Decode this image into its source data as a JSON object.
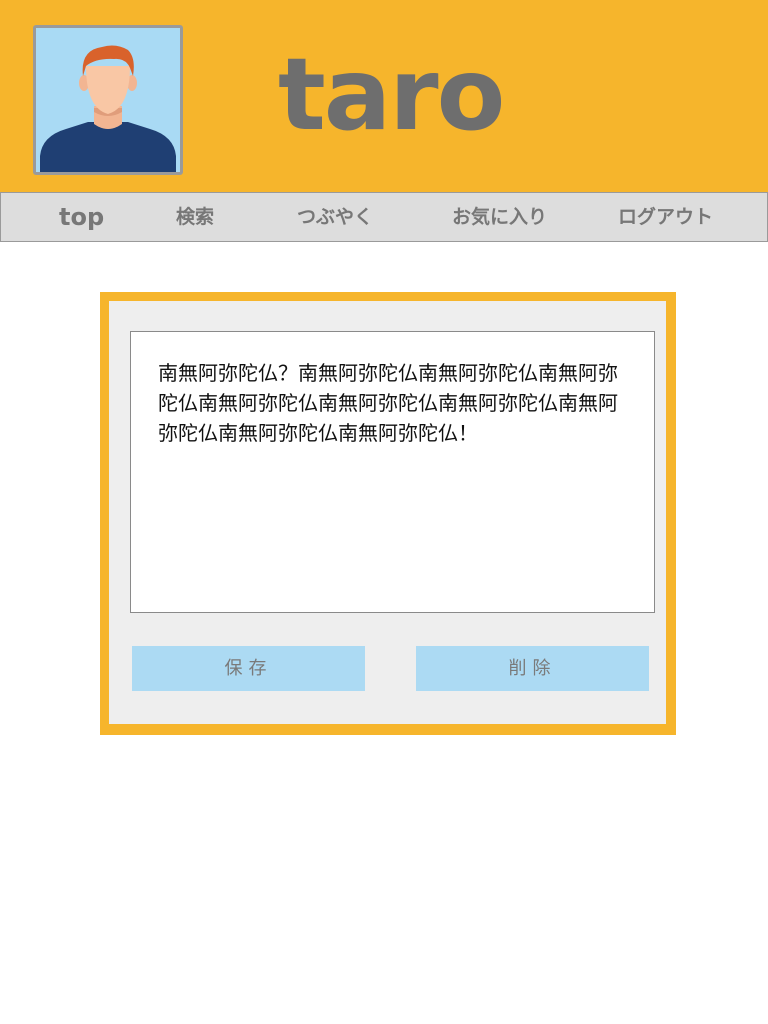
{
  "header": {
    "username": "taro",
    "avatar_icon": "user-avatar-icon",
    "background_color": "#F6B52C"
  },
  "nav": {
    "items": [
      {
        "label": "top"
      },
      {
        "label": "検索"
      },
      {
        "label": "つぶやく"
      },
      {
        "label": "お気に入り"
      },
      {
        "label": "ログアウト"
      }
    ]
  },
  "post": {
    "text": "南無阿弥陀仏？南無阿弥陀仏南無阿弥陀仏南無阿弥陀仏南無阿弥陀仏南無阿弥陀仏南無阿弥陀仏南無阿弥陀仏南無阿弥陀仏南無阿弥陀仏！"
  },
  "actions": {
    "save_label": "保存",
    "delete_label": "削除",
    "button_color": "#ACDAF3"
  }
}
